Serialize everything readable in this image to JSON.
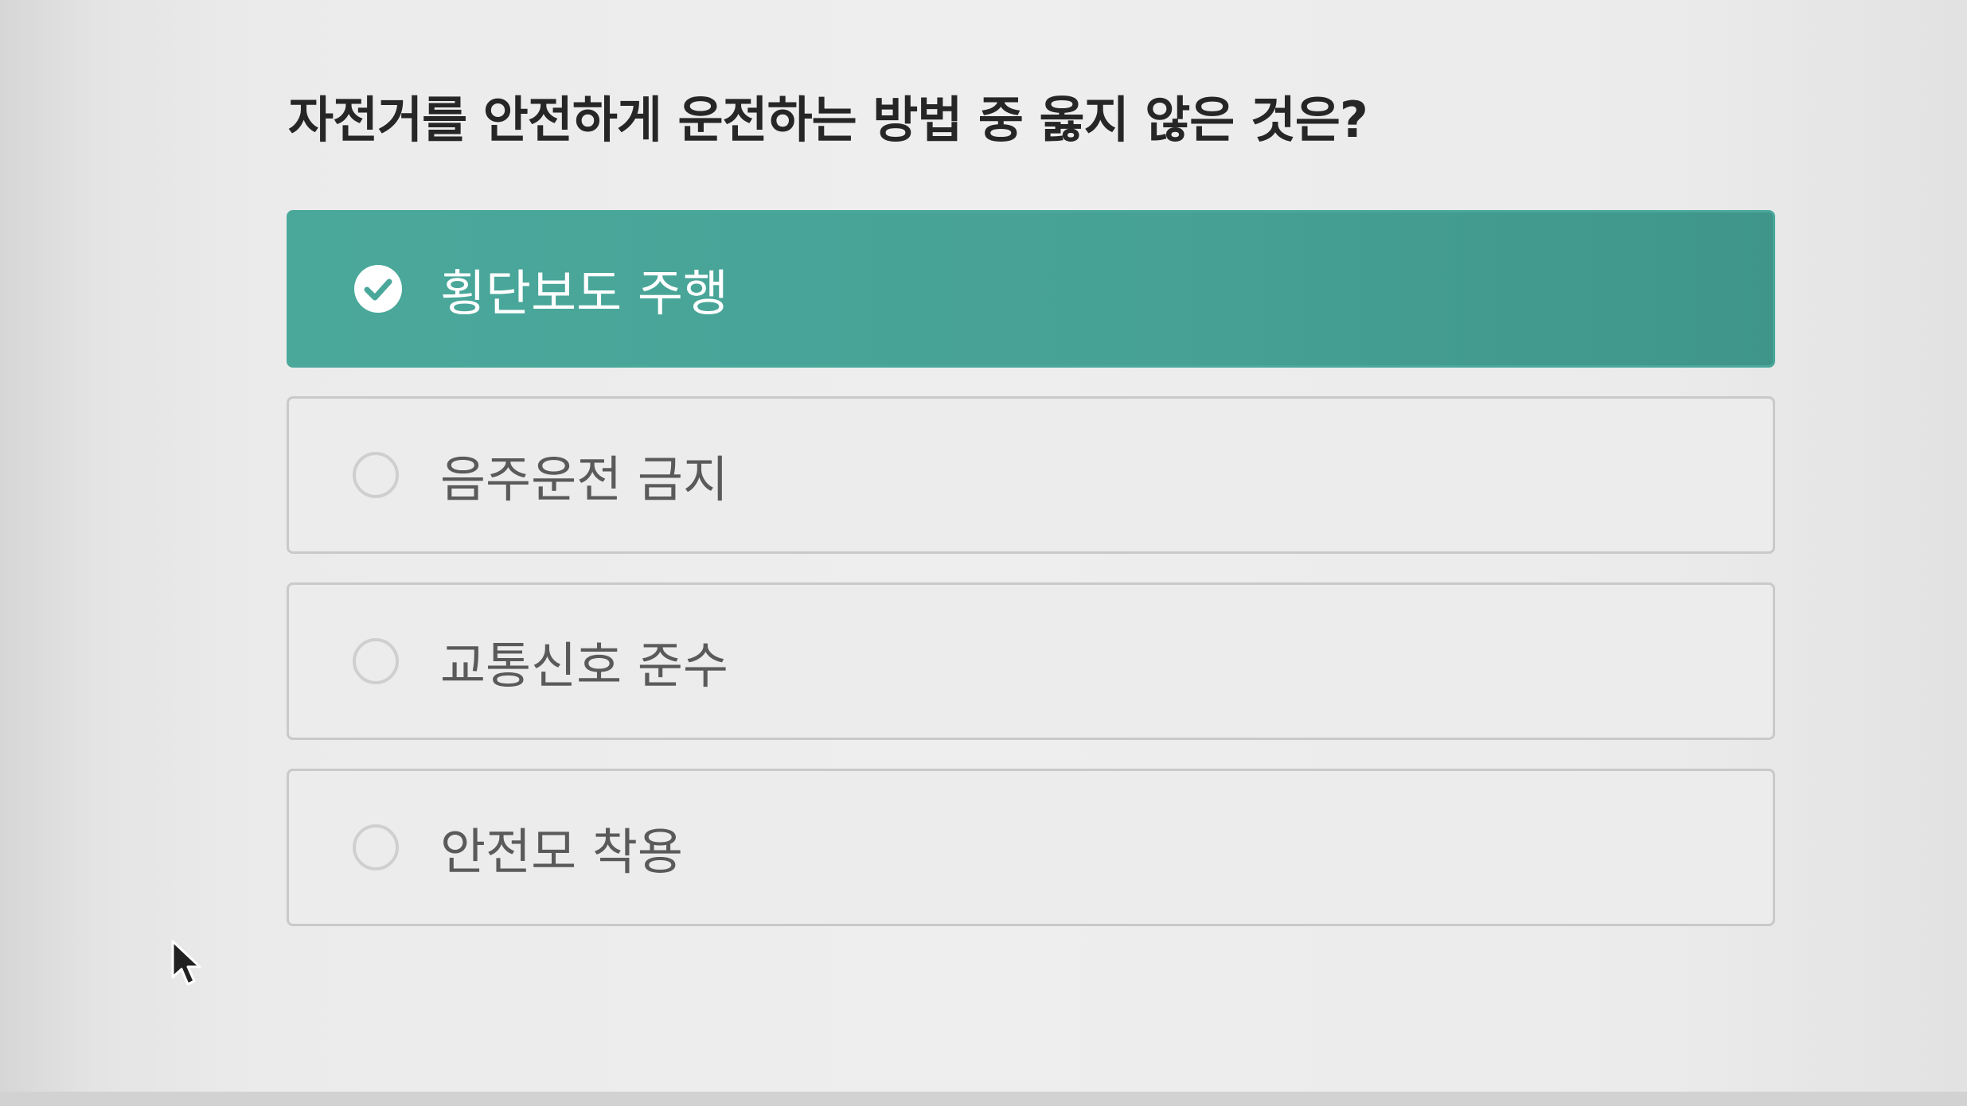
{
  "question": {
    "text": "자전거를 안전하게 운전하는 방법 중 옳지 않은 것은?"
  },
  "options": [
    {
      "label": "횡단보도 주행",
      "selected": true
    },
    {
      "label": "음주운전 금지",
      "selected": false
    },
    {
      "label": "교통신호 준수",
      "selected": false
    },
    {
      "label": "안전모 착용",
      "selected": false
    }
  ],
  "colors": {
    "selected_background": "#4aa89b",
    "selected_text": "#ffffff",
    "unselected_text": "#5a5a5a",
    "border": "#c9c9c9"
  },
  "icons": {
    "selected": "check-circle-icon",
    "unselected": "radio-empty-icon",
    "pointer": "mouse-pointer-icon"
  }
}
